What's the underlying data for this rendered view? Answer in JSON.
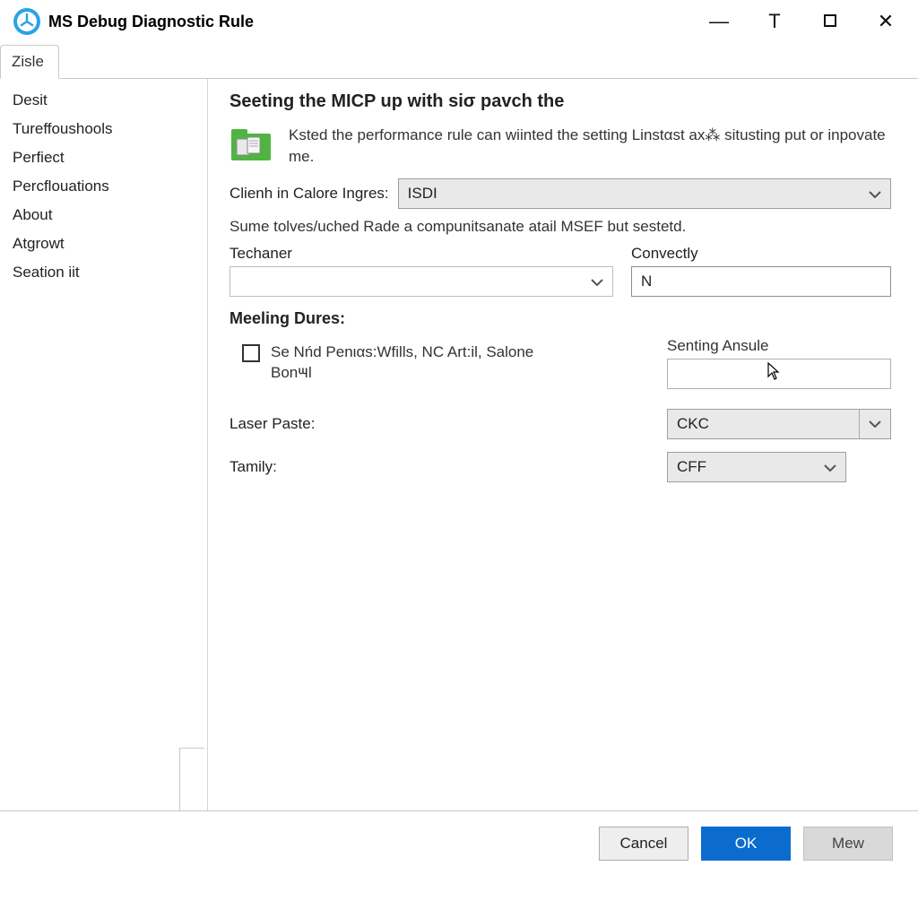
{
  "titlebar": {
    "title": "MS Debug Diagnostic Rule",
    "pin_symbol": "T"
  },
  "tabs": [
    {
      "label": "Zisle"
    }
  ],
  "sidebar": {
    "items": [
      {
        "label": "Desit"
      },
      {
        "label": "Tureffoushools"
      },
      {
        "label": "Perfiect"
      },
      {
        "label": "Percflouations"
      },
      {
        "label": "About"
      },
      {
        "label": "Atgrowt"
      },
      {
        "label": "Seation iit"
      }
    ]
  },
  "main": {
    "heading": "Seeting the MICP up with siσ pavch the",
    "info_text": "Ksted the performance rule can wiinted the setting Linstαst ax⁂ situsting put or inpovate me.",
    "clienh_label": "Clienh in Calore Ingres:",
    "clienh_value": "ISDI",
    "note": "Sume tolves/uched Rade a compunitsanate atail MSEF but sestetd.",
    "techaner_label": "Techaner",
    "techaner_value": "",
    "convectly_label": "Convectly",
    "convectly_value": "N",
    "meeling_label": "Meeling Dures:",
    "checkbox_label": "Se Nńd Penιαs:Wfills, NC Art:il, Salone Bon౻l",
    "senting_label": "Senting Ansule",
    "senting_value": "",
    "laser_label": "Laser Paste:",
    "laser_value": "CKC",
    "tamily_label": "Tamily:",
    "tamily_value": "CFF"
  },
  "footer": {
    "cancel": "Cancel",
    "ok": "OK",
    "mew": "Mew"
  }
}
